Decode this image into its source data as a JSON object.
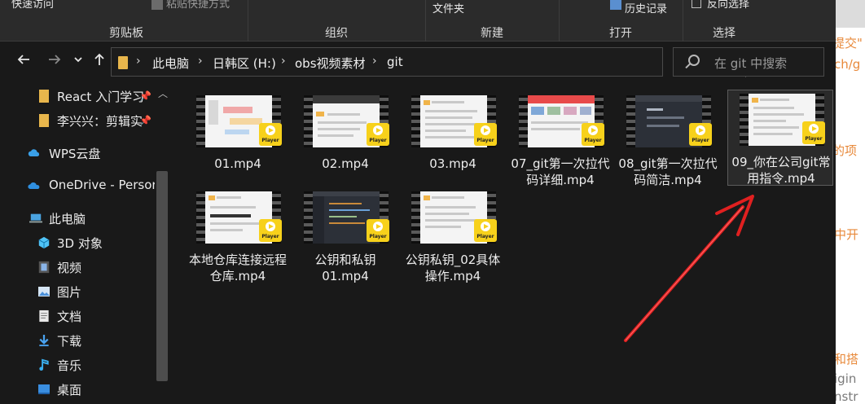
{
  "ribbon": {
    "partial_items": [
      {
        "label": "快速访问"
      },
      {
        "label": "粘贴快捷方式"
      },
      {
        "label": "文件夹"
      },
      {
        "label": "历史记录"
      },
      {
        "label": "反向选择"
      }
    ],
    "groups": [
      {
        "label": "剪贴板"
      },
      {
        "label": "组织"
      },
      {
        "label": "新建"
      },
      {
        "label": "打开"
      },
      {
        "label": "选择"
      }
    ]
  },
  "navigation": {
    "back_icon": "arrow-left-icon",
    "forward_icon": "arrow-right-icon",
    "recent_icon": "chevron-down-icon",
    "up_icon": "arrow-up-icon"
  },
  "address": {
    "crumbs": [
      "此电脑",
      "日韩区 (H:)",
      "obs视频素材",
      "git"
    ]
  },
  "search": {
    "placeholder": "在 git 中搜索"
  },
  "sidebar": {
    "items": [
      {
        "label": "React 入门学习",
        "icon": "folder-icon",
        "pinned": true
      },
      {
        "label": "李兴兴：剪辑实",
        "icon": "folder-icon",
        "pinned": true
      },
      {
        "label": "WPS云盘",
        "icon": "cloud-icon"
      },
      {
        "label": "OneDrive - Persor",
        "icon": "onedrive-icon"
      },
      {
        "label": "此电脑",
        "icon": "computer-icon"
      },
      {
        "label": "3D 对象",
        "icon": "cube-icon"
      },
      {
        "label": "视频",
        "icon": "video-icon"
      },
      {
        "label": "图片",
        "icon": "picture-icon"
      },
      {
        "label": "文档",
        "icon": "document-icon"
      },
      {
        "label": "下载",
        "icon": "download-icon"
      },
      {
        "label": "音乐",
        "icon": "music-icon"
      },
      {
        "label": "桌面",
        "icon": "desktop-icon"
      }
    ]
  },
  "files": [
    {
      "name": "01.mp4",
      "selected": false,
      "thumb": "doc"
    },
    {
      "name": "02.mp4",
      "selected": false,
      "thumb": "doc"
    },
    {
      "name": "03.mp4",
      "selected": false,
      "thumb": "doc"
    },
    {
      "name": "07_git第一次拉代码详细.mp4",
      "selected": false,
      "thumb": "web"
    },
    {
      "name": "08_git第一次拉代码简洁.mp4",
      "selected": false,
      "thumb": "dark"
    },
    {
      "name": "09_你在公司git常用指令.mp4",
      "selected": true,
      "thumb": "doc"
    },
    {
      "name": "本地仓库连接远程仓库.mp4",
      "selected": false,
      "thumb": "doc"
    },
    {
      "name": "公钥和私钥01.mp4",
      "selected": false,
      "thumb": "dark"
    },
    {
      "name": "公钥私钥_02具体操作.mp4",
      "selected": false,
      "thumb": "doc"
    }
  ],
  "badge_text": "Player",
  "background_window": {
    "snippets": [
      "提交\"",
      "ch/g",
      "的项",
      "中开",
      "和搭",
      "igin",
      "nstr"
    ]
  },
  "colors": {
    "accent_annotation": "#e02020",
    "player_badge": "#f7d11b",
    "folder": "#e8b64c",
    "background_text": "#e8893a"
  }
}
